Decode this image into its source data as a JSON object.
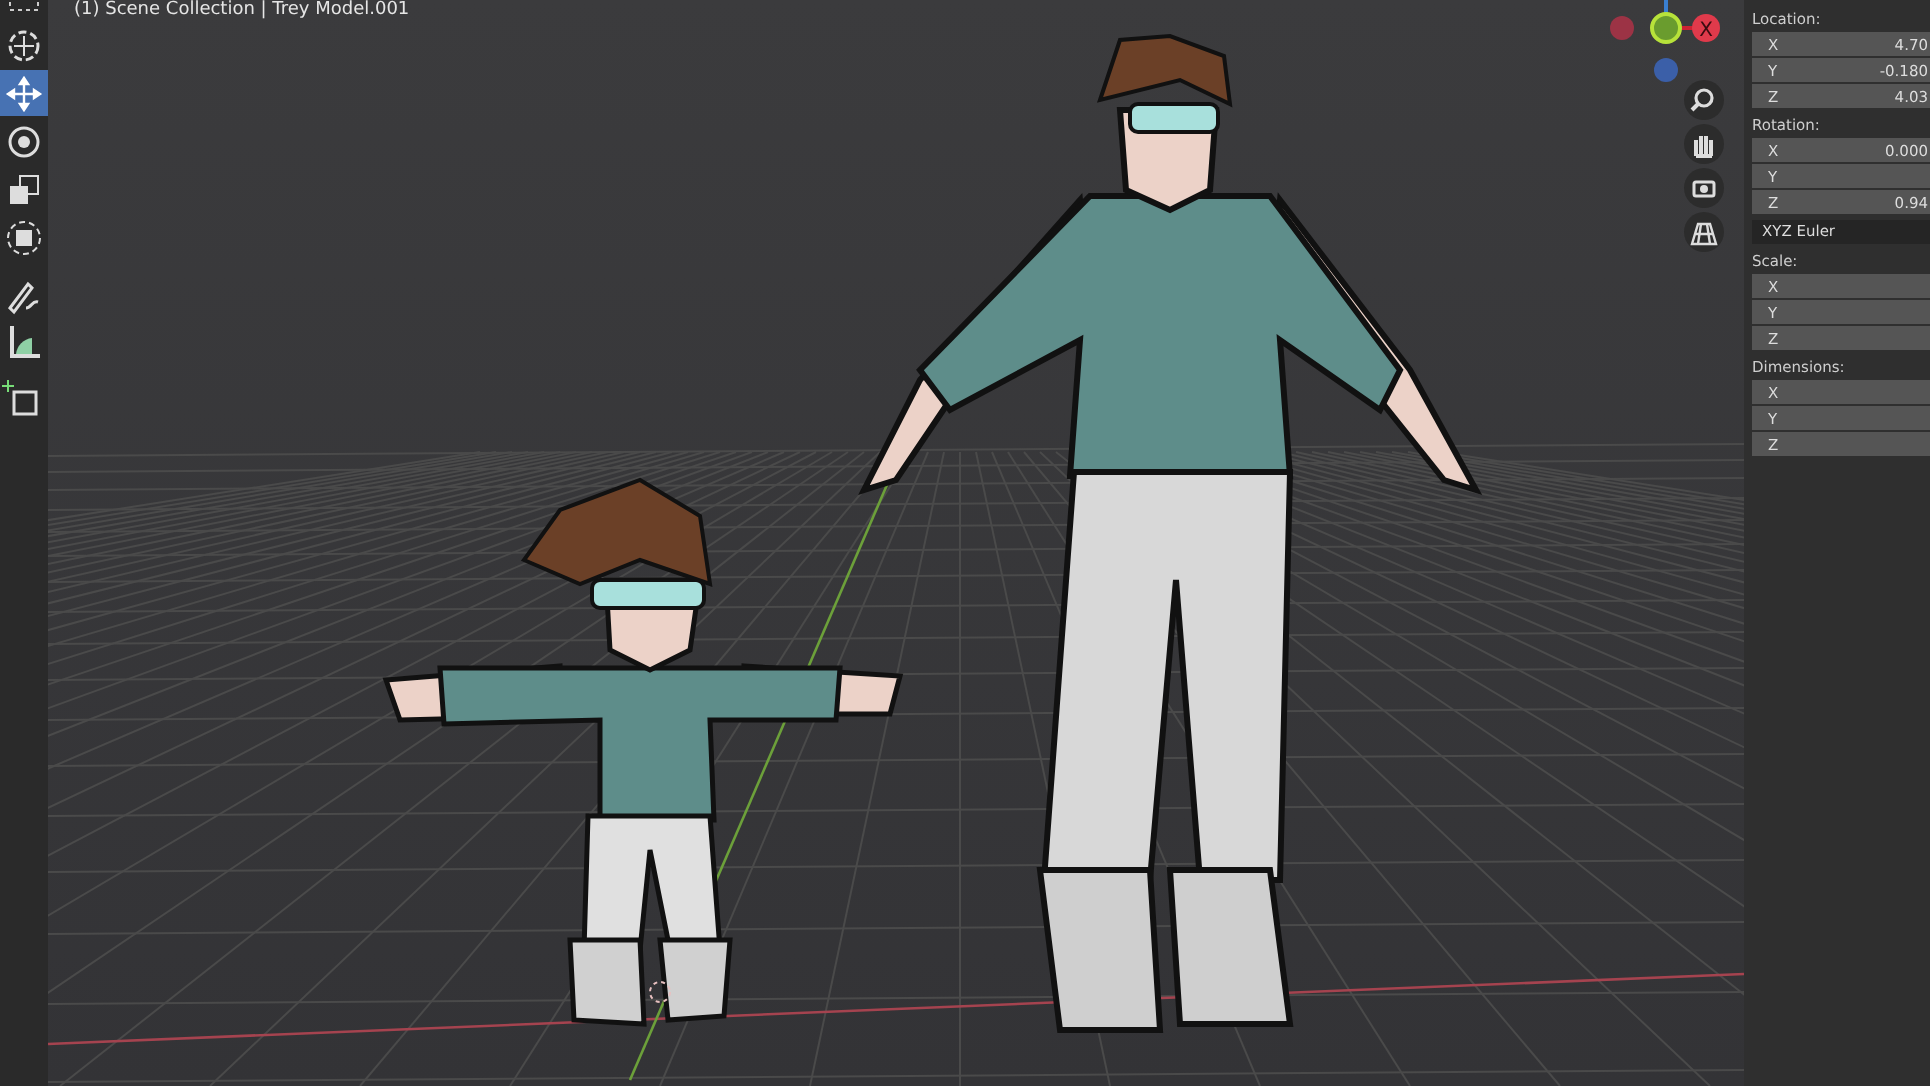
{
  "viewport": {
    "header": "(1) Scene Collection | Trey Model.001"
  },
  "toolbar": {
    "tools": [
      {
        "selected": false
      },
      {
        "selected": false
      },
      {
        "selected": true
      },
      {
        "selected": false
      },
      {
        "selected": false
      },
      {
        "selected": false
      },
      {
        "selected": false
      },
      {
        "selected": false
      },
      {
        "selected": false
      }
    ]
  },
  "gizmo": {
    "x_label": "X"
  },
  "properties": {
    "sections": [
      {
        "label": "Location:",
        "fields": [
          {
            "axis": "X",
            "value": "4.70"
          },
          {
            "axis": "Y",
            "value": "-0.180"
          },
          {
            "axis": "Z",
            "value": "4.03"
          }
        ]
      },
      {
        "label": "Rotation:",
        "fields": [
          {
            "axis": "X",
            "value": "0.000"
          },
          {
            "axis": "Y"
          },
          {
            "axis": "Z",
            "value": "0.94"
          }
        ],
        "mode": "XYZ Euler"
      },
      {
        "label": "Scale:",
        "fields": [
          {
            "axis": "X"
          },
          {
            "axis": "Y"
          },
          {
            "axis": "Z"
          }
        ]
      },
      {
        "label": "Dimensions:",
        "fields": [
          {
            "axis": "X"
          },
          {
            "axis": "Y"
          },
          {
            "axis": "Z"
          }
        ]
      }
    ]
  }
}
